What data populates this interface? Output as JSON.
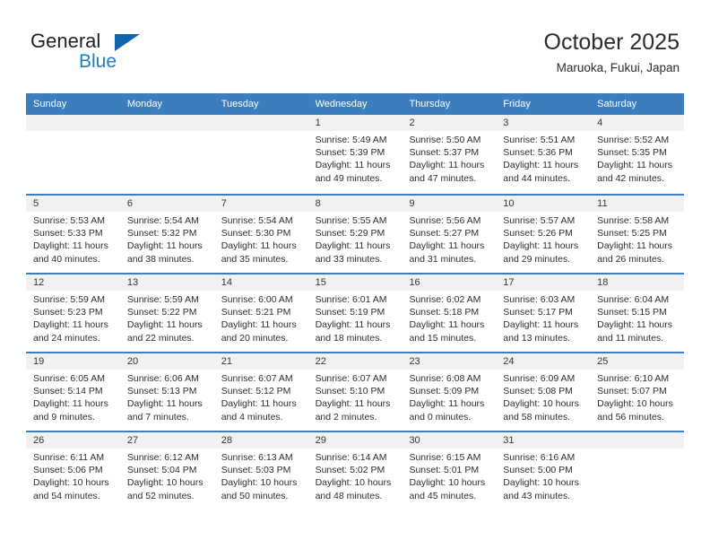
{
  "brand": {
    "name_primary": "General",
    "name_secondary": "Blue",
    "triangle_color": "#1166ab",
    "blue_color": "#1a7fc1"
  },
  "header": {
    "title": "October 2025",
    "subtitle": "Maruoka, Fukui, Japan"
  },
  "theme": {
    "header_bar_color": "#3c7ebd",
    "day_number_strip_color": "#f1f1f1",
    "text_color": "#2d2d2d"
  },
  "calendar": {
    "weekdays": [
      "Sunday",
      "Monday",
      "Tuesday",
      "Wednesday",
      "Thursday",
      "Friday",
      "Saturday"
    ],
    "weeks": [
      [
        {
          "day": "",
          "lines": []
        },
        {
          "day": "",
          "lines": []
        },
        {
          "day": "",
          "lines": []
        },
        {
          "day": "1",
          "lines": [
            "Sunrise: 5:49 AM",
            "Sunset: 5:39 PM",
            "Daylight: 11 hours",
            "and 49 minutes."
          ]
        },
        {
          "day": "2",
          "lines": [
            "Sunrise: 5:50 AM",
            "Sunset: 5:37 PM",
            "Daylight: 11 hours",
            "and 47 minutes."
          ]
        },
        {
          "day": "3",
          "lines": [
            "Sunrise: 5:51 AM",
            "Sunset: 5:36 PM",
            "Daylight: 11 hours",
            "and 44 minutes."
          ]
        },
        {
          "day": "4",
          "lines": [
            "Sunrise: 5:52 AM",
            "Sunset: 5:35 PM",
            "Daylight: 11 hours",
            "and 42 minutes."
          ]
        }
      ],
      [
        {
          "day": "5",
          "lines": [
            "Sunrise: 5:53 AM",
            "Sunset: 5:33 PM",
            "Daylight: 11 hours",
            "and 40 minutes."
          ]
        },
        {
          "day": "6",
          "lines": [
            "Sunrise: 5:54 AM",
            "Sunset: 5:32 PM",
            "Daylight: 11 hours",
            "and 38 minutes."
          ]
        },
        {
          "day": "7",
          "lines": [
            "Sunrise: 5:54 AM",
            "Sunset: 5:30 PM",
            "Daylight: 11 hours",
            "and 35 minutes."
          ]
        },
        {
          "day": "8",
          "lines": [
            "Sunrise: 5:55 AM",
            "Sunset: 5:29 PM",
            "Daylight: 11 hours",
            "and 33 minutes."
          ]
        },
        {
          "day": "9",
          "lines": [
            "Sunrise: 5:56 AM",
            "Sunset: 5:27 PM",
            "Daylight: 11 hours",
            "and 31 minutes."
          ]
        },
        {
          "day": "10",
          "lines": [
            "Sunrise: 5:57 AM",
            "Sunset: 5:26 PM",
            "Daylight: 11 hours",
            "and 29 minutes."
          ]
        },
        {
          "day": "11",
          "lines": [
            "Sunrise: 5:58 AM",
            "Sunset: 5:25 PM",
            "Daylight: 11 hours",
            "and 26 minutes."
          ]
        }
      ],
      [
        {
          "day": "12",
          "lines": [
            "Sunrise: 5:59 AM",
            "Sunset: 5:23 PM",
            "Daylight: 11 hours",
            "and 24 minutes."
          ]
        },
        {
          "day": "13",
          "lines": [
            "Sunrise: 5:59 AM",
            "Sunset: 5:22 PM",
            "Daylight: 11 hours",
            "and 22 minutes."
          ]
        },
        {
          "day": "14",
          "lines": [
            "Sunrise: 6:00 AM",
            "Sunset: 5:21 PM",
            "Daylight: 11 hours",
            "and 20 minutes."
          ]
        },
        {
          "day": "15",
          "lines": [
            "Sunrise: 6:01 AM",
            "Sunset: 5:19 PM",
            "Daylight: 11 hours",
            "and 18 minutes."
          ]
        },
        {
          "day": "16",
          "lines": [
            "Sunrise: 6:02 AM",
            "Sunset: 5:18 PM",
            "Daylight: 11 hours",
            "and 15 minutes."
          ]
        },
        {
          "day": "17",
          "lines": [
            "Sunrise: 6:03 AM",
            "Sunset: 5:17 PM",
            "Daylight: 11 hours",
            "and 13 minutes."
          ]
        },
        {
          "day": "18",
          "lines": [
            "Sunrise: 6:04 AM",
            "Sunset: 5:15 PM",
            "Daylight: 11 hours",
            "and 11 minutes."
          ]
        }
      ],
      [
        {
          "day": "19",
          "lines": [
            "Sunrise: 6:05 AM",
            "Sunset: 5:14 PM",
            "Daylight: 11 hours",
            "and 9 minutes."
          ]
        },
        {
          "day": "20",
          "lines": [
            "Sunrise: 6:06 AM",
            "Sunset: 5:13 PM",
            "Daylight: 11 hours",
            "and 7 minutes."
          ]
        },
        {
          "day": "21",
          "lines": [
            "Sunrise: 6:07 AM",
            "Sunset: 5:12 PM",
            "Daylight: 11 hours",
            "and 4 minutes."
          ]
        },
        {
          "day": "22",
          "lines": [
            "Sunrise: 6:07 AM",
            "Sunset: 5:10 PM",
            "Daylight: 11 hours",
            "and 2 minutes."
          ]
        },
        {
          "day": "23",
          "lines": [
            "Sunrise: 6:08 AM",
            "Sunset: 5:09 PM",
            "Daylight: 11 hours",
            "and 0 minutes."
          ]
        },
        {
          "day": "24",
          "lines": [
            "Sunrise: 6:09 AM",
            "Sunset: 5:08 PM",
            "Daylight: 10 hours",
            "and 58 minutes."
          ]
        },
        {
          "day": "25",
          "lines": [
            "Sunrise: 6:10 AM",
            "Sunset: 5:07 PM",
            "Daylight: 10 hours",
            "and 56 minutes."
          ]
        }
      ],
      [
        {
          "day": "26",
          "lines": [
            "Sunrise: 6:11 AM",
            "Sunset: 5:06 PM",
            "Daylight: 10 hours",
            "and 54 minutes."
          ]
        },
        {
          "day": "27",
          "lines": [
            "Sunrise: 6:12 AM",
            "Sunset: 5:04 PM",
            "Daylight: 10 hours",
            "and 52 minutes."
          ]
        },
        {
          "day": "28",
          "lines": [
            "Sunrise: 6:13 AM",
            "Sunset: 5:03 PM",
            "Daylight: 10 hours",
            "and 50 minutes."
          ]
        },
        {
          "day": "29",
          "lines": [
            "Sunrise: 6:14 AM",
            "Sunset: 5:02 PM",
            "Daylight: 10 hours",
            "and 48 minutes."
          ]
        },
        {
          "day": "30",
          "lines": [
            "Sunrise: 6:15 AM",
            "Sunset: 5:01 PM",
            "Daylight: 10 hours",
            "and 45 minutes."
          ]
        },
        {
          "day": "31",
          "lines": [
            "Sunrise: 6:16 AM",
            "Sunset: 5:00 PM",
            "Daylight: 10 hours",
            "and 43 minutes."
          ]
        },
        {
          "day": "",
          "lines": []
        }
      ]
    ]
  }
}
